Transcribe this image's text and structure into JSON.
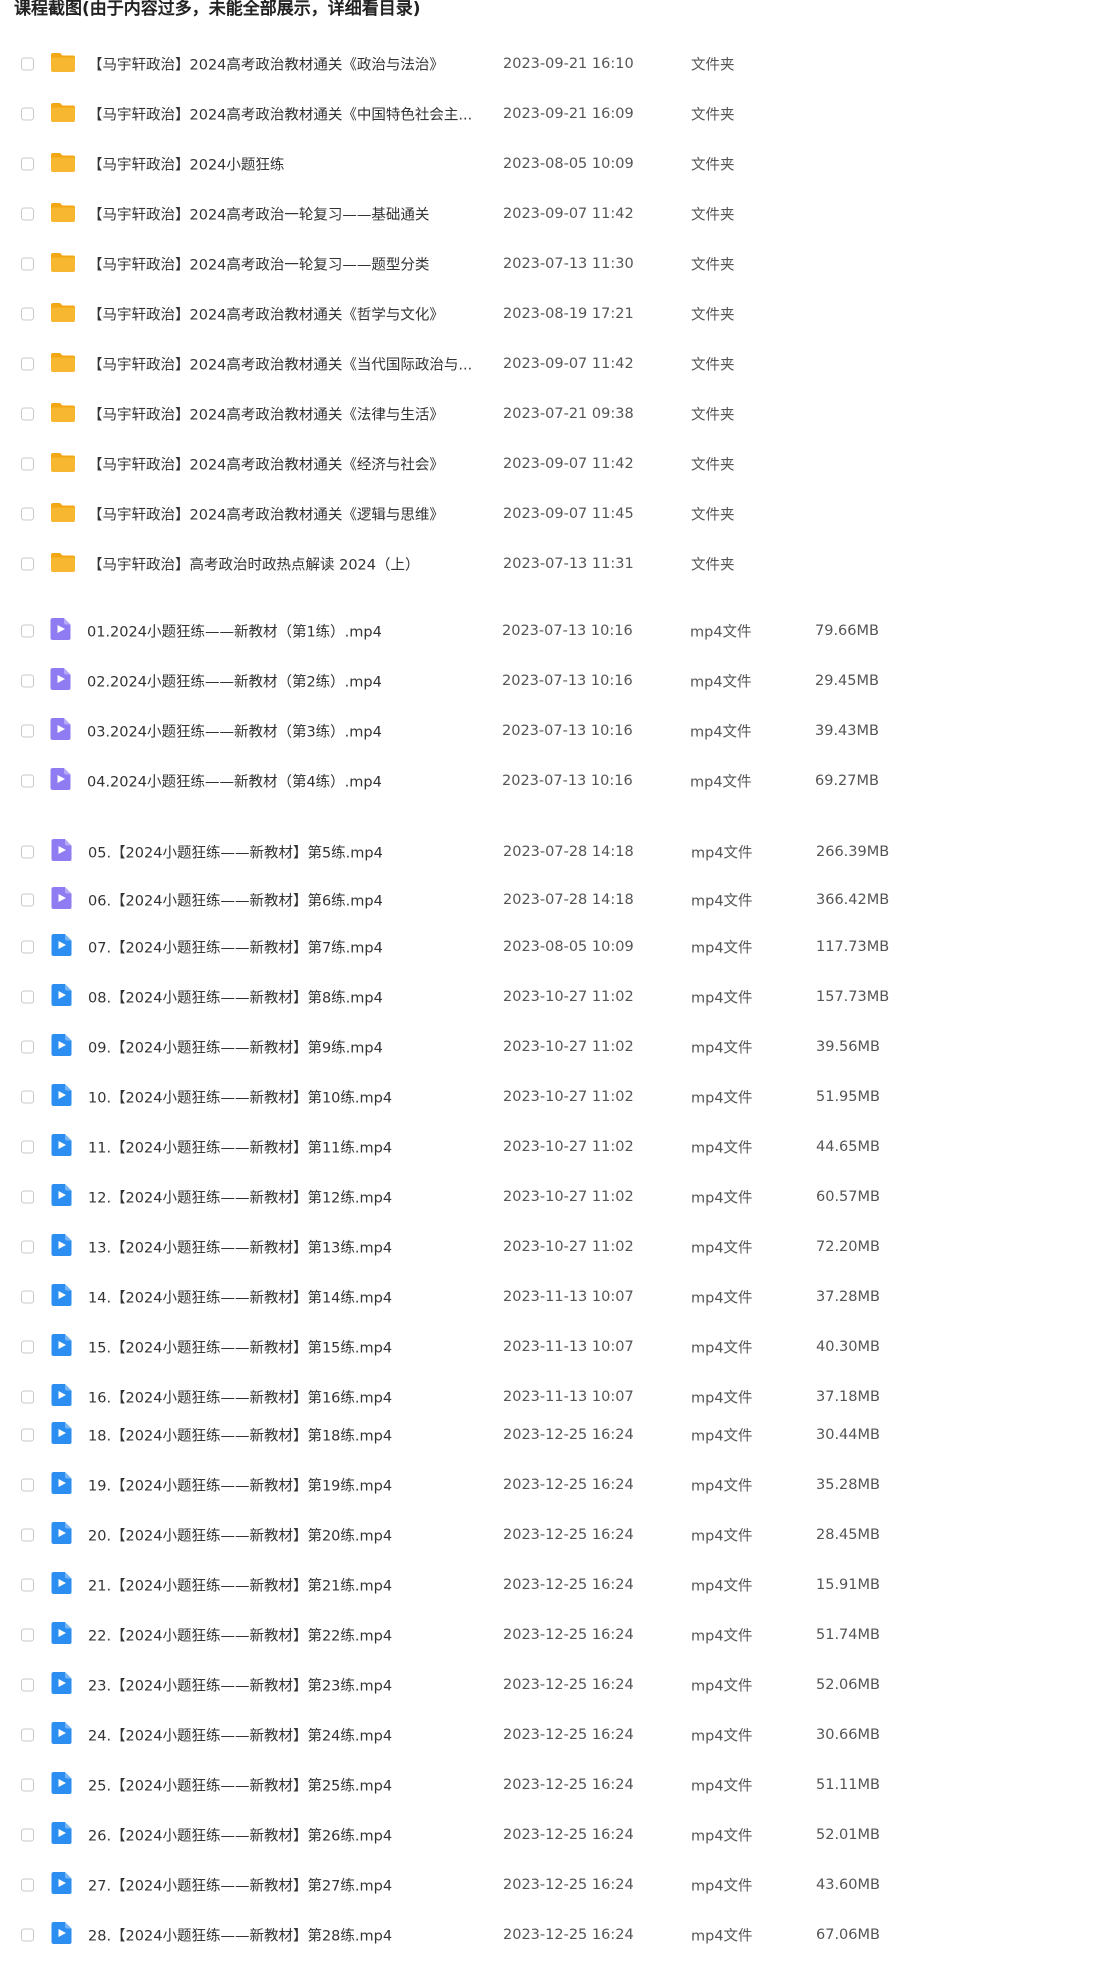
{
  "page_title": "课程截图(由于内容过多，未能全部展示，详细看目录)",
  "colors": {
    "folder": "#f7b731",
    "folder_tab": "#f3a712",
    "video_purple": "#8f7cf2",
    "video_blue": "#2b8ef0"
  },
  "folders": [
    {
      "name": "【马宇轩政治】2024高考政治教材通关《政治与法治》",
      "date": "2023-09-21 16:10",
      "type": "文件夹"
    },
    {
      "name": "【马宇轩政治】2024高考政治教材通关《中国特色社会主...",
      "date": "2023-09-21 16:09",
      "type": "文件夹"
    },
    {
      "name": "【马宇轩政治】2024小题狂练",
      "date": "2023-08-05 10:09",
      "type": "文件夹"
    },
    {
      "name": "【马宇轩政治】2024高考政治一轮复习——基础通关",
      "date": "2023-09-07 11:42",
      "type": "文件夹"
    },
    {
      "name": "【马宇轩政治】2024高考政治一轮复习——题型分类",
      "date": "2023-07-13 11:30",
      "type": "文件夹"
    },
    {
      "name": "【马宇轩政治】2024高考政治教材通关《哲学与文化》",
      "date": "2023-08-19 17:21",
      "type": "文件夹"
    },
    {
      "name": "【马宇轩政治】2024高考政治教材通关《当代国际政治与...",
      "date": "2023-09-07 11:42",
      "type": "文件夹"
    },
    {
      "name": "【马宇轩政治】2024高考政治教材通关《法律与生活》",
      "date": "2023-07-21 09:38",
      "type": "文件夹"
    },
    {
      "name": "【马宇轩政治】2024高考政治教材通关《经济与社会》",
      "date": "2023-09-07 11:42",
      "type": "文件夹"
    },
    {
      "name": "【马宇轩政治】2024高考政治教材通关《逻辑与思维》",
      "date": "2023-09-07 11:45",
      "type": "文件夹"
    },
    {
      "name": "【马宇轩政治】高考政治时政热点解读 2024（上）",
      "date": "2023-07-13 11:31",
      "type": "文件夹"
    }
  ],
  "videos_a": [
    {
      "name": "01.2024小题狂练——新教材（第1练）.mp4",
      "date": "2023-07-13 10:16",
      "type": "mp4文件",
      "size": "79.66MB"
    },
    {
      "name": "02.2024小题狂练——新教材（第2练）.mp4",
      "date": "2023-07-13 10:16",
      "type": "mp4文件",
      "size": "29.45MB"
    },
    {
      "name": "03.2024小题狂练——新教材（第3练）.mp4",
      "date": "2023-07-13 10:16",
      "type": "mp4文件",
      "size": "39.43MB"
    },
    {
      "name": "04.2024小题狂练——新教材（第4练）.mp4",
      "date": "2023-07-13 10:16",
      "type": "mp4文件",
      "size": "69.27MB"
    }
  ],
  "videos_b": [
    {
      "name": "05.【2024小题狂练——新教材】第5练.mp4",
      "date": "2023-07-28 14:18",
      "type": "mp4文件",
      "size": "266.39MB",
      "icon": "purple"
    },
    {
      "name": "06.【2024小题狂练——新教材】第6练.mp4",
      "date": "2023-07-28 14:18",
      "type": "mp4文件",
      "size": "366.42MB",
      "icon": "purple"
    },
    {
      "name": "07.【2024小题狂练——新教材】第7练.mp4",
      "date": "2023-08-05 10:09",
      "type": "mp4文件",
      "size": "117.73MB",
      "icon": "blue"
    },
    {
      "name": "08.【2024小题狂练——新教材】第8练.mp4",
      "date": "2023-10-27 11:02",
      "type": "mp4文件",
      "size": "157.73MB",
      "icon": "blue"
    },
    {
      "name": "09.【2024小题狂练——新教材】第9练.mp4",
      "date": "2023-10-27 11:02",
      "type": "mp4文件",
      "size": "39.56MB",
      "icon": "blue"
    },
    {
      "name": "10.【2024小题狂练——新教材】第10练.mp4",
      "date": "2023-10-27 11:02",
      "type": "mp4文件",
      "size": "51.95MB",
      "icon": "blue"
    },
    {
      "name": "11.【2024小题狂练——新教材】第11练.mp4",
      "date": "2023-10-27 11:02",
      "type": "mp4文件",
      "size": "44.65MB",
      "icon": "blue"
    },
    {
      "name": "12.【2024小题狂练——新教材】第12练.mp4",
      "date": "2023-10-27 11:02",
      "type": "mp4文件",
      "size": "60.57MB",
      "icon": "blue"
    },
    {
      "name": "13.【2024小题狂练——新教材】第13练.mp4",
      "date": "2023-10-27 11:02",
      "type": "mp4文件",
      "size": "72.20MB",
      "icon": "blue"
    },
    {
      "name": "14.【2024小题狂练——新教材】第14练.mp4",
      "date": "2023-11-13 10:07",
      "type": "mp4文件",
      "size": "37.28MB",
      "icon": "blue"
    },
    {
      "name": "15.【2024小题狂练——新教材】第15练.mp4",
      "date": "2023-11-13 10:07",
      "type": "mp4文件",
      "size": "40.30MB",
      "icon": "blue"
    },
    {
      "name": "16.【2024小题狂练——新教材】第16练.mp4",
      "date": "2023-11-13 10:07",
      "type": "mp4文件",
      "size": "37.18MB",
      "icon": "blue"
    },
    {
      "name": "18.【2024小题狂练——新教材】第18练.mp4",
      "date": "2023-12-25 16:24",
      "type": "mp4文件",
      "size": "30.44MB",
      "icon": "blue"
    },
    {
      "name": "19.【2024小题狂练——新教材】第19练.mp4",
      "date": "2023-12-25 16:24",
      "type": "mp4文件",
      "size": "35.28MB",
      "icon": "blue"
    },
    {
      "name": "20.【2024小题狂练——新教材】第20练.mp4",
      "date": "2023-12-25 16:24",
      "type": "mp4文件",
      "size": "28.45MB",
      "icon": "blue"
    },
    {
      "name": "21.【2024小题狂练——新教材】第21练.mp4",
      "date": "2023-12-25 16:24",
      "type": "mp4文件",
      "size": "15.91MB",
      "icon": "blue"
    },
    {
      "name": "22.【2024小题狂练——新教材】第22练.mp4",
      "date": "2023-12-25 16:24",
      "type": "mp4文件",
      "size": "51.74MB",
      "icon": "blue"
    },
    {
      "name": "23.【2024小题狂练——新教材】第23练.mp4",
      "date": "2023-12-25 16:24",
      "type": "mp4文件",
      "size": "52.06MB",
      "icon": "blue"
    },
    {
      "name": "24.【2024小题狂练——新教材】第24练.mp4",
      "date": "2023-12-25 16:24",
      "type": "mp4文件",
      "size": "30.66MB",
      "icon": "blue"
    },
    {
      "name": "25.【2024小题狂练——新教材】第25练.mp4",
      "date": "2023-12-25 16:24",
      "type": "mp4文件",
      "size": "51.11MB",
      "icon": "blue"
    },
    {
      "name": "26.【2024小题狂练——新教材】第26练.mp4",
      "date": "2023-12-25 16:24",
      "type": "mp4文件",
      "size": "52.01MB",
      "icon": "blue"
    },
    {
      "name": "27.【2024小题狂练——新教材】第27练.mp4",
      "date": "2023-12-25 16:24",
      "type": "mp4文件",
      "size": "43.60MB",
      "icon": "blue"
    },
    {
      "name": "28.【2024小题狂练——新教材】第28练.mp4",
      "date": "2023-12-25 16:24",
      "type": "mp4文件",
      "size": "67.06MB",
      "icon": "blue"
    }
  ]
}
